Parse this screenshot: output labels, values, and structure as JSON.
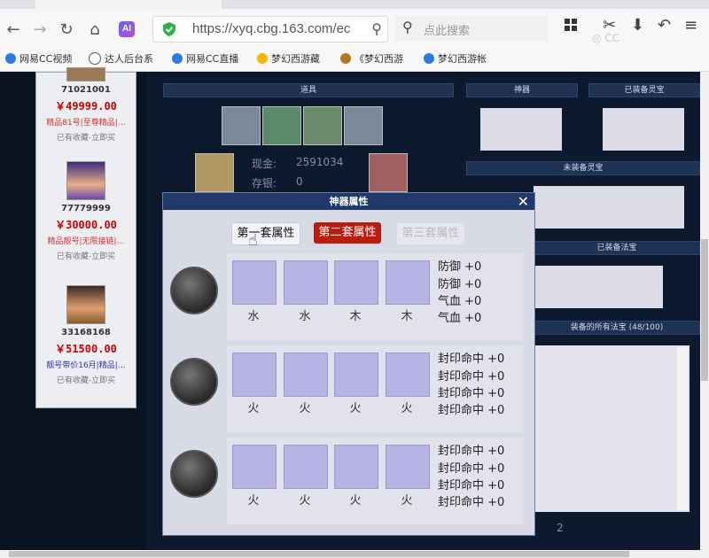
{
  "browser": {
    "url": "https://xyq.cbg.163.com/ec",
    "search_placeholder": "点此搜索",
    "bookmarks": [
      "网易CC视频",
      "达人后台系",
      "网易CC直播",
      "梦幻西游藏",
      "《梦幻西游",
      "梦幻西游帐"
    ]
  },
  "sidebar": {
    "sellers": [
      {
        "id": "71021001",
        "price": "￥49999.00",
        "line1": "精品81号|至尊精品|…",
        "line2": "已有收藏-立即买"
      },
      {
        "id": "77779999",
        "price": "￥30000.00",
        "line1": "精品靓号|无限接链|…",
        "line2": "已有收藏-立即买"
      },
      {
        "id": "33168168",
        "price": "￥51500.00",
        "line1": "靓号带价16月|精品|…",
        "line2": "已有收藏-立即买"
      }
    ]
  },
  "background": {
    "props_header": "道具",
    "artifact_header": "神器",
    "equipped_spirit_header": "已装备灵宝",
    "unequipped_spirit_header": "未装备灵宝",
    "equipped_treasure_header": "已装备法宝",
    "all_treasure_header": "装备的所有法宝 (48/100)",
    "cash_label": "现金:",
    "cash_value": "2591034",
    "deposit_label": "存银:",
    "deposit_value": "0",
    "footer_value": "2"
  },
  "modal": {
    "title": "神器属性",
    "tabs": [
      "第一套属性",
      "第二套属性",
      "第三套属性"
    ],
    "active_tab": 1,
    "rows": [
      {
        "elements": [
          "水",
          "水",
          "木",
          "木"
        ],
        "attrs": [
          "防御 +0",
          "防御 +0",
          "气血 +0",
          "气血 +0"
        ]
      },
      {
        "elements": [
          "火",
          "火",
          "火",
          "火"
        ],
        "attrs": [
          "封印命中 +0",
          "封印命中 +0",
          "封印命中 +0",
          "封印命中 +0"
        ]
      },
      {
        "elements": [
          "火",
          "火",
          "火",
          "火"
        ],
        "attrs": [
          "封印命中 +0",
          "封印命中 +0",
          "封印命中 +0",
          "封印命中 +0"
        ]
      }
    ]
  },
  "colors": {
    "active_tab": "#b81d10",
    "slot": "#b7b3e2",
    "modal_header": "#1f3a6a"
  }
}
